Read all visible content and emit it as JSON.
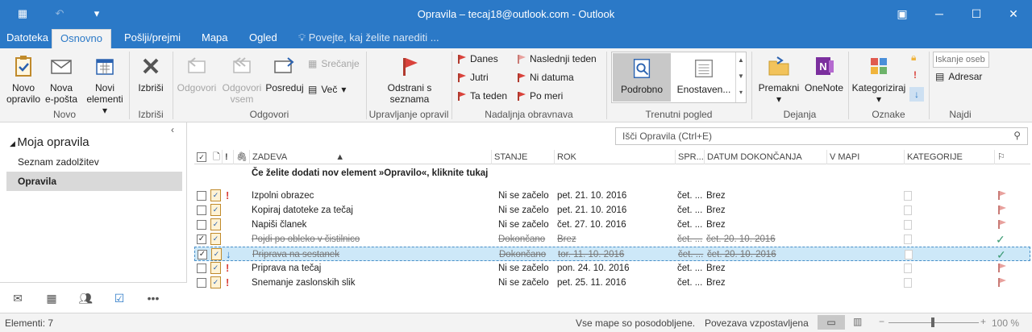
{
  "window": {
    "title": "Opravila – tecaj18@outlook.com - Outlook"
  },
  "tabs": [
    "Datoteka",
    "Osnovno",
    "Pošlji/prejmi",
    "Mapa",
    "Ogled"
  ],
  "tell_me": "Povejte, kaj želite narediti ...",
  "ribbon": {
    "novo_opravilo": "Novo\nopravilo",
    "nova_eposta": "Nova\ne-pošta",
    "novi_elementi": "Novi\nelementi",
    "group_novo": "Novo",
    "izbrisi": "Izbriši",
    "group_izbrisi": "Izbriši",
    "odgovori": "Odgovori",
    "odgovori_vsem": "Odgovori\nvsem",
    "posredujs": "Posreduj",
    "srecanje": "Srečanje",
    "vec": "Več",
    "group_odgovori": "Odgovori",
    "odstrani": "Odstrani s\nseznama",
    "group_upravljanje": "Upravljanje opravil",
    "danes": "Danes",
    "jutri": "Jutri",
    "ta_teden": "Ta teden",
    "naslednji_teden": "Naslednji teden",
    "ni_datuma": "Ni datuma",
    "po_meri": "Po meri",
    "group_nadaljnja": "Nadaljnja obravnava",
    "podrobno": "Podrobno",
    "enostaven": "Enostaven...",
    "group_pogled": "Trenutni pogled",
    "premakni": "Premakni",
    "onenote": "OneNote",
    "group_dejanja": "Dejanja",
    "kategoriziraj": "Kategoriziraj",
    "group_oznake": "Oznake",
    "iskanje_placeholder": "Iskanje oseb",
    "adresar": "Adresar",
    "group_najdi": "Najdi"
  },
  "left": {
    "section": "Moja opravila",
    "items": [
      "Seznam zadolžitev",
      "Opravila"
    ]
  },
  "search": {
    "placeholder": "Išči Opravila (Ctrl+E)"
  },
  "columns": {
    "zadeva": "ZADEVA",
    "stanje": "STANJE",
    "rok": "ROK",
    "spr": "SPR...",
    "datum": "DATUM DOKONČANJA",
    "vmapi": "V MAPI",
    "kategorije": "KATEGORIJE"
  },
  "new_item_hint": "Če želite dodati nov element »Opravilo«, kliknite tukaj",
  "tasks": [
    {
      "subject": "Izpolni obrazec",
      "status": "Ni se začelo",
      "due": "pet. 21. 10. 2016",
      "mod": "čet. ...",
      "done": "Brez",
      "importance": "high",
      "completed": false
    },
    {
      "subject": "Kopiraj datoteke za tečaj",
      "status": "Ni se začelo",
      "due": "pet. 21. 10. 2016",
      "mod": "čet. ...",
      "done": "Brez",
      "importance": "normal",
      "completed": false
    },
    {
      "subject": "Napiši članek",
      "status": "Ni se začelo",
      "due": "čet. 27. 10. 2016",
      "mod": "čet. ...",
      "done": "Brez",
      "importance": "normal",
      "completed": false
    },
    {
      "subject": "Pojdi po obleko v čistilnico",
      "status": "Dokončano",
      "due": "Brez",
      "mod": "čet. ...",
      "done": "čet. 20. 10. 2016",
      "importance": "normal",
      "completed": true
    },
    {
      "subject": "Priprava na sestanek",
      "status": "Dokončano",
      "due": "tor. 11. 10. 2016",
      "mod": "čet. ...",
      "done": "čet. 20. 10. 2016",
      "importance": "low",
      "completed": true
    },
    {
      "subject": "Priprava na tečaj",
      "status": "Ni se začelo",
      "due": "pon. 24. 10. 2016",
      "mod": "čet. ...",
      "done": "Brez",
      "importance": "high",
      "completed": false
    },
    {
      "subject": "Snemanje zaslonskih slik",
      "status": "Ni se začelo",
      "due": "pet. 25. 11. 2016",
      "mod": "čet. ...",
      "done": "Brez",
      "importance": "high",
      "completed": false
    }
  ],
  "status": {
    "items": "Elementi: 7",
    "sync": "Vse mape so posodobljene.",
    "conn": "Povezava vzpostavljena",
    "zoom": "100 %"
  }
}
